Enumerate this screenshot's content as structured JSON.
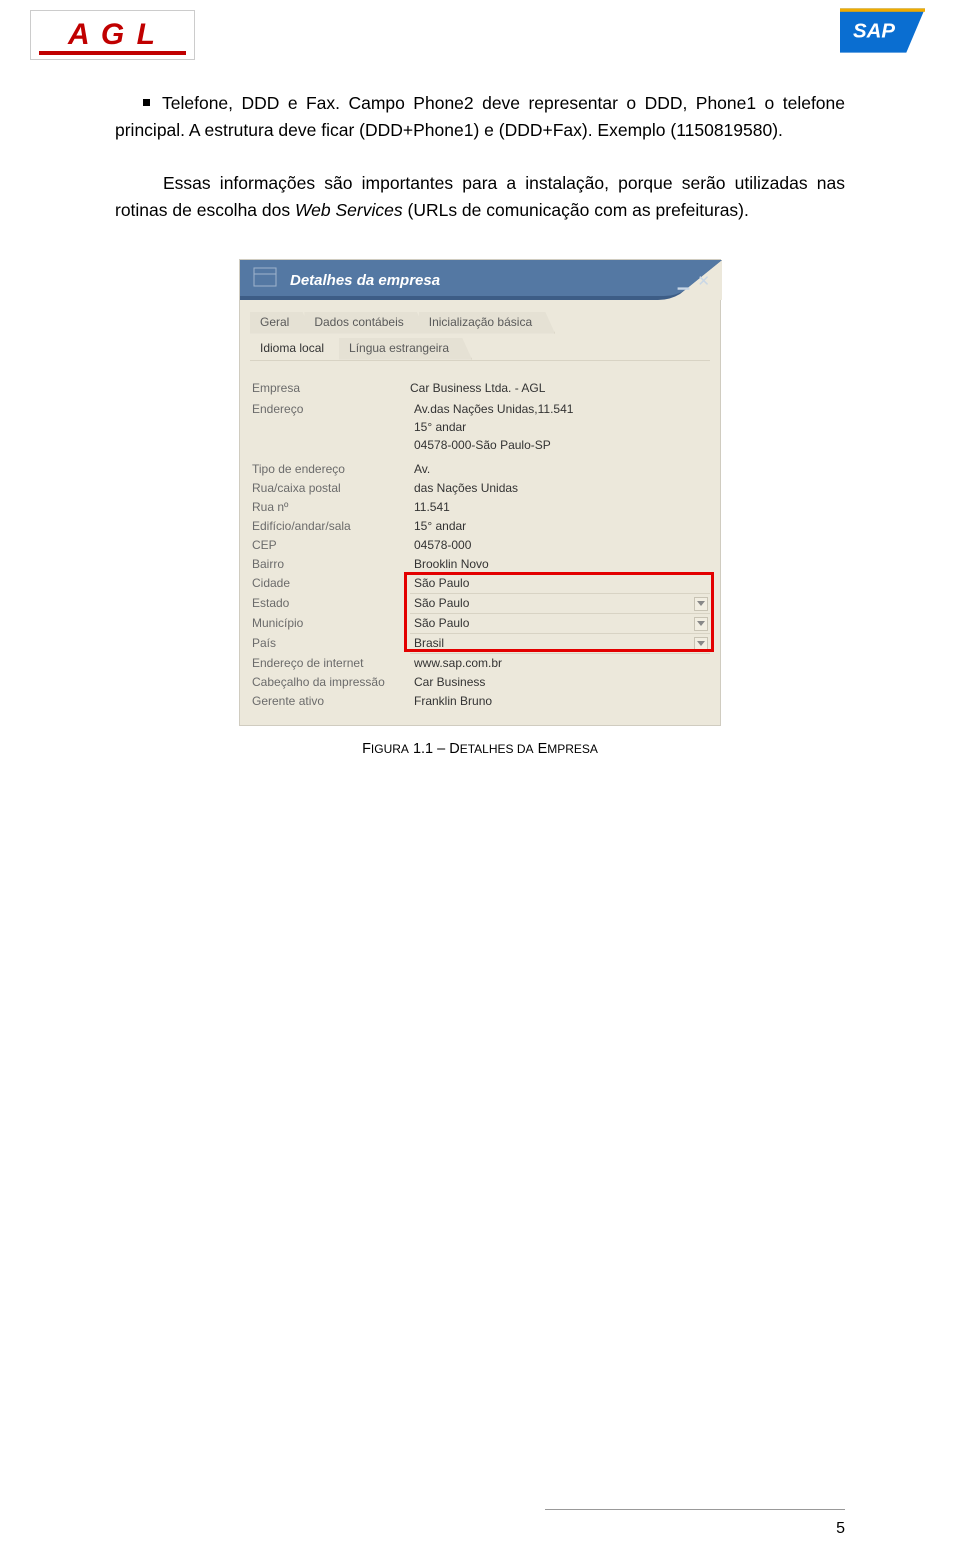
{
  "logos": {
    "agl_text": "A G L",
    "sap_text": "SAP"
  },
  "body": {
    "bullet_first_line": "Telefone, DDD e Fax. Campo Phone2 deve representar o DDD, Phone1 o telefone",
    "bullet_rest": "principal. A estrutura deve ficar (DDD+Phone1) e (DDD+Fax). Exemplo (1150819580).",
    "para2_a": "Essas informações são importantes para a instalação, porque serão utilizadas nas rotinas de escolha dos ",
    "para2_italic": "Web Services",
    "para2_b": "  (URLs de comunicação com as  prefeituras)."
  },
  "panel": {
    "title": "Detalhes da empresa",
    "tabs_row1": [
      "Geral",
      "Dados contábeis",
      "Inicialização básica"
    ],
    "tabs_row2": [
      "Idioma local",
      "Língua estrangeira"
    ],
    "fields": [
      {
        "label": "Empresa",
        "value": "Car Business Ltda. - AGL",
        "highlight": true
      },
      {
        "label": "Endereço",
        "value": "",
        "multiline": [
          "Av.das Nações Unidas,11.541",
          "15° andar",
          "04578-000-São Paulo-SP"
        ]
      },
      {
        "label": "Tipo de endereço",
        "value": "Av."
      },
      {
        "label": "Rua/caixa postal",
        "value": "das Nações Unidas"
      },
      {
        "label": "Rua nº",
        "value": "11.541"
      },
      {
        "label": "Edifício/andar/sala",
        "value": "15° andar"
      },
      {
        "label": "CEP",
        "value": "04578-000"
      },
      {
        "label": "Bairro",
        "value": "Brooklin Novo"
      },
      {
        "label": "Cidade",
        "value": "São Paulo",
        "red": true
      },
      {
        "label": "Estado",
        "value": "São Paulo",
        "dropdown": true,
        "red": true
      },
      {
        "label": "Município",
        "value": "São Paulo",
        "dropdown": true,
        "red": true
      },
      {
        "label": "País",
        "value": "Brasil",
        "dropdown": true,
        "red": true
      },
      {
        "label": "Endereço de internet",
        "value": "www.sap.com.br"
      },
      {
        "label": "Cabeçalho da impressão",
        "value": "Car Business"
      },
      {
        "label": "Gerente ativo",
        "value": "Franklin Bruno"
      }
    ]
  },
  "caption_a": "Figura 1.1 – D",
  "caption_b": "etalhes da ",
  "caption_c": "E",
  "caption_d": "mpresa",
  "page_number": "5"
}
